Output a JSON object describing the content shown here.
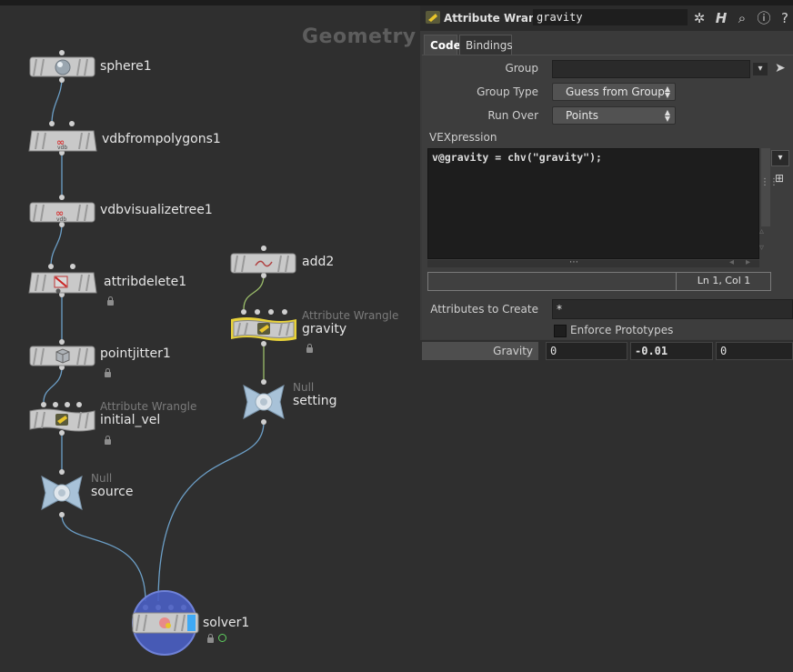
{
  "network": {
    "context_title": "Geometry",
    "nodes": {
      "sphere": {
        "name": "sphere1"
      },
      "vdbfrompolygons": {
        "name": "vdbfrompolygons1"
      },
      "vdbvisualizetree": {
        "name": "vdbvisualizetree1"
      },
      "attribdelete": {
        "name": "attribdelete1"
      },
      "pointjitter": {
        "name": "pointjitter1"
      },
      "initial_vel": {
        "type": "Attribute Wrangle",
        "name": "initial_vel"
      },
      "source": {
        "type": "Null",
        "name": "source"
      },
      "add": {
        "name": "add2"
      },
      "gravity": {
        "type": "Attribute Wrangle",
        "name": "gravity"
      },
      "setting": {
        "type": "Null",
        "name": "setting"
      },
      "solver": {
        "name": "solver1"
      }
    }
  },
  "parm_panel": {
    "node_type": "Attribute Wrangle",
    "node_name": "gravity",
    "toolbar_icons": [
      "gear-icon",
      "houdini-help-icon",
      "search-icon",
      "info-icon",
      "help-icon"
    ],
    "tabs": [
      {
        "label": "Code",
        "active": true
      },
      {
        "label": "Bindings",
        "active": false
      }
    ],
    "group": {
      "label": "Group",
      "value": ""
    },
    "group_type": {
      "label": "Group Type",
      "value": "Guess from Group"
    },
    "run_over": {
      "label": "Run Over",
      "value": "Points"
    },
    "vexpression": {
      "label": "VEXpression",
      "code": "v@gravity = chv(\"gravity\");",
      "cursor_status": "Ln 1, Col 1"
    },
    "attributes_to_create": {
      "label": "Attributes to Create",
      "value": "*"
    },
    "enforce_prototypes": {
      "label": "Enforce Prototypes",
      "checked": false
    },
    "gravity": {
      "label": "Gravity",
      "values": [
        "0",
        "-0.01",
        "0"
      ]
    }
  },
  "colors": {
    "background": "#2f2f2f",
    "selected_node_outline": "#e8d23a",
    "wire": "#6c9fc7",
    "wire_selected": "#9bbd6a",
    "solver_circle": "#4a5fc4"
  }
}
